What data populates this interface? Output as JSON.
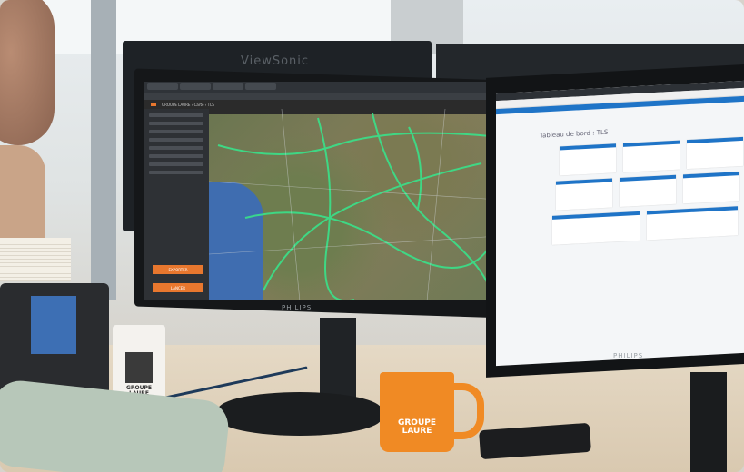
{
  "photo": {
    "rear_monitor_brand": "ViewSonic",
    "main_monitor_brand": "PHILIPS",
    "right_monitor_brand": "PHILIPS",
    "white_cup_text": "GROUPE LAURE",
    "orange_mug_text": "GROUPE LAURE"
  },
  "main_screen": {
    "app_breadcrumb": "GROUPE LAURE › Carte › TLS",
    "sidebar_button_1": "EXPORTER",
    "sidebar_button_2": "LANCER"
  },
  "right_screen": {
    "dashboard_title": "Tableau de bord : TLS"
  },
  "colors": {
    "brand_orange": "#e8772e",
    "dashboard_blue": "#1f74c7",
    "map_road_green": "#39e28a",
    "sea_blue": "#3f6db0"
  }
}
